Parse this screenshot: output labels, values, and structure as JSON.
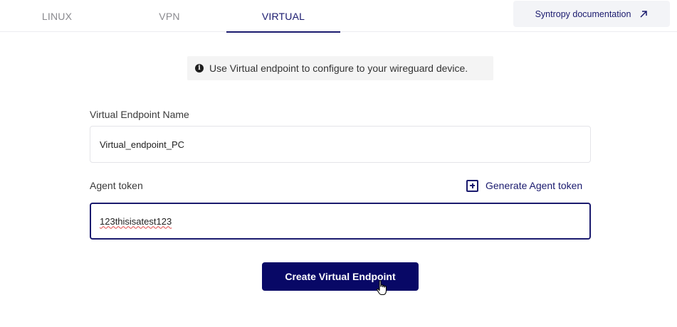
{
  "tabs": [
    {
      "label": "LINUX",
      "active": false
    },
    {
      "label": "VPN",
      "active": false
    },
    {
      "label": "VIRTUAL",
      "active": true
    }
  ],
  "doc_link": {
    "label": "Syntropy documentation",
    "icon": "external-arrow-icon"
  },
  "info": {
    "icon": "info-icon",
    "icon_glyph": "i",
    "text": "Use Virtual endpoint to configure to your wireguard device."
  },
  "form": {
    "name_label": "Virtual Endpoint Name",
    "name_value": "Virtual_endpoint_PC",
    "token_label": "Agent token",
    "token_value": "123thisisatest123",
    "generate_label": "Generate Agent token",
    "submit_label": "Create Virtual Endpoint"
  },
  "colors": {
    "accent": "#1a1a6e",
    "button_bg": "#080866",
    "inactive_tab": "#8a8a8f"
  }
}
